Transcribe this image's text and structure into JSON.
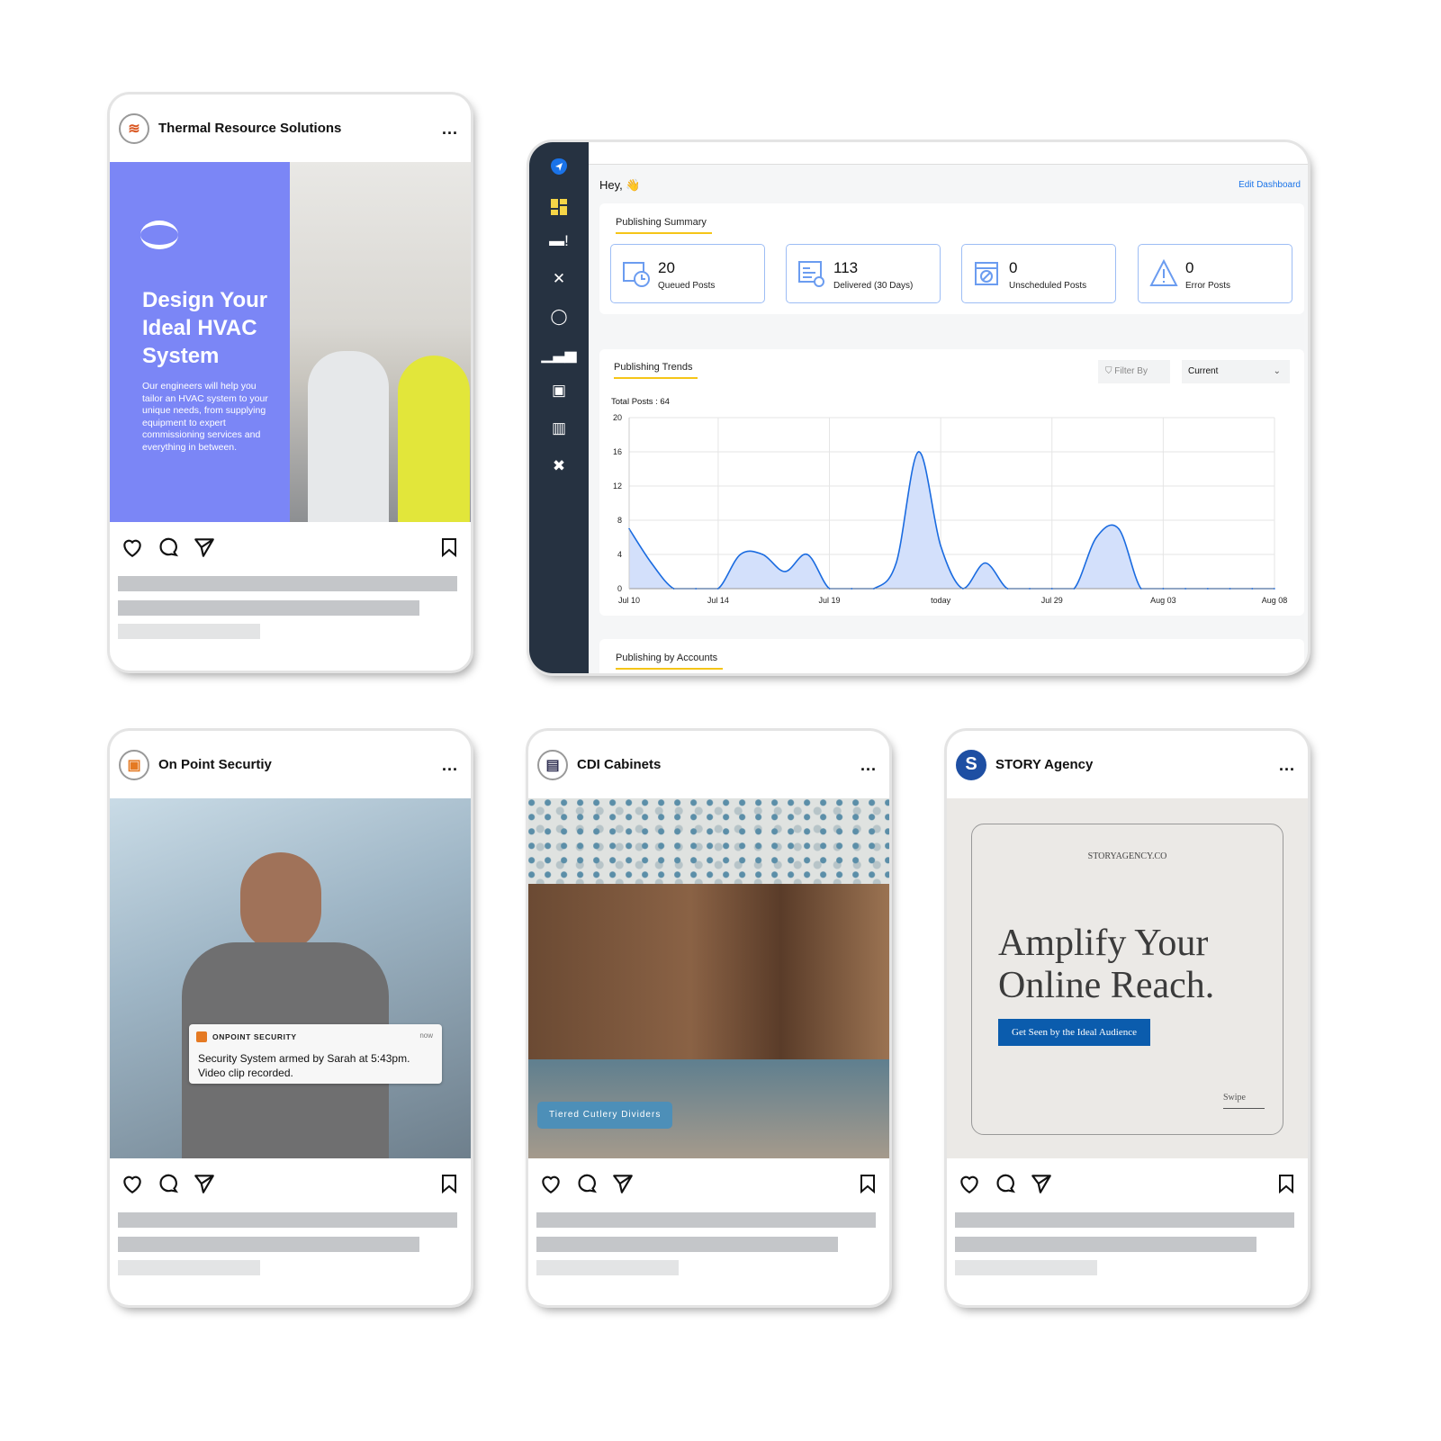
{
  "posts": [
    {
      "account": "Thermal Resource Solutions",
      "headline": "Design Your Ideal HVAC System",
      "body": "Our engineers will help you tailor an HVAC system to your unique needs, from supplying equipment to expert commissioning services and everything in between.",
      "brand_color": "#7b86f6"
    },
    {
      "account": "On Point Securtiy",
      "notification": {
        "app": "ONPOINT SECURITY",
        "time": "now",
        "line1": "Security System armed by Sarah at 5:43pm.",
        "line2": "Video clip recorded."
      }
    },
    {
      "account": "CDI Cabinets",
      "tag": "Tiered Cutlery Dividers"
    },
    {
      "account": "STORY Agency",
      "avatar_letter": "S",
      "site": "STORYAGENCY.CO",
      "headline_1": "Amplify Your",
      "headline_2": "Online Reach.",
      "cta": "Get Seen by the Ideal Audience",
      "swipe": "Swipe",
      "cta_color": "#0b5cad"
    }
  ],
  "more_label": "...",
  "dashboard": {
    "greeting": "Hey, 👋",
    "edit_link": "Edit Dashboard",
    "summary_title": "Publishing Summary",
    "stats": [
      {
        "value": "20",
        "label": "Queued Posts",
        "icon": "calendar-clock-icon"
      },
      {
        "value": "113",
        "label": "Delivered (30 Days)",
        "icon": "delivered-doc-icon"
      },
      {
        "value": "0",
        "label": "Unscheduled Posts",
        "icon": "calendar-blocked-icon"
      },
      {
        "value": "0",
        "label": "Error Posts",
        "icon": "warning-icon"
      }
    ],
    "trends_title": "Publishing Trends",
    "filter_label": "Filter By",
    "filter_value": "Current",
    "total_posts": "Total Posts : 64",
    "accounts_title": "Publishing by Accounts",
    "sidebar_icons": [
      "send-icon",
      "dashboard-icon",
      "comment-alert-icon",
      "network-icon",
      "target-icon",
      "analytics-icon",
      "inbox-icon",
      "library-icon",
      "tools-icon"
    ],
    "accent": "#1a73e8"
  },
  "chart_data": {
    "type": "area",
    "x": [
      "Jul 10",
      "Jul 11",
      "Jul 12",
      "Jul 13",
      "Jul 14",
      "Jul 15",
      "Jul 16",
      "Jul 17",
      "Jul 18",
      "Jul 19",
      "Jul 20",
      "Jul 21",
      "Jul 22",
      "Jul 23",
      "Jul 24",
      "Jul 25",
      "Jul 26",
      "Jul 27",
      "Jul 28",
      "Jul 29",
      "Jul 30",
      "Jul 31",
      "Aug 01",
      "Aug 02",
      "Aug 03",
      "Aug 04",
      "Aug 05",
      "Aug 06",
      "Aug 07",
      "Aug 08"
    ],
    "values": [
      7,
      3,
      0,
      0,
      0,
      4,
      4,
      2,
      4,
      0,
      0,
      0,
      3,
      16,
      5,
      0,
      3,
      0,
      0,
      0,
      0,
      6,
      7,
      0,
      0,
      0,
      0,
      0,
      0,
      0
    ],
    "xticks": [
      {
        "i": 0,
        "label": "Jul 10"
      },
      {
        "i": 4,
        "label": "Jul 14"
      },
      {
        "i": 9,
        "label": "Jul 19"
      },
      {
        "i": 14,
        "label": "today"
      },
      {
        "i": 19,
        "label": "Jul 29"
      },
      {
        "i": 24,
        "label": "Aug 03"
      },
      {
        "i": 29,
        "label": "Aug 08"
      }
    ],
    "yticks": [
      "0",
      "4",
      "8",
      "12",
      "16",
      "20"
    ],
    "ylim": [
      0,
      20
    ],
    "grid": true,
    "line_color": "#1a6be0",
    "fill_color": "#d3e0fb"
  }
}
